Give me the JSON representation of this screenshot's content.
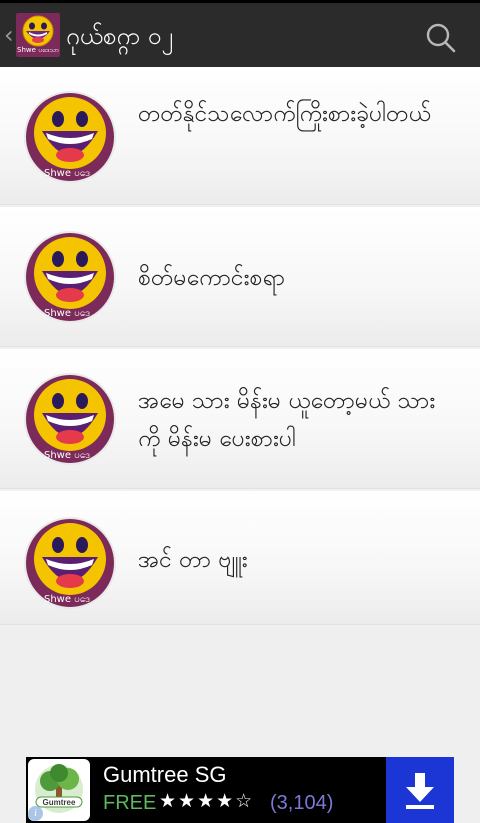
{
  "topbar": {
    "back_glyph": "‹",
    "app_icon_name": "smiley-app-icon",
    "app_icon_label": "Shwe ပဒေသာ",
    "title": "ဂုယ်စဂ္ဂာ ၀၂",
    "search_icon": "search-icon"
  },
  "list": {
    "items": [
      {
        "title": "တတ်နိုင်သလောက်ကြိုးစားခဲ့ပါတယ်",
        "avatar_caption": "Shwe ပဒေ",
        "icon": "laughing-face-icon"
      },
      {
        "title": "စိတ်မကောင်းစရာ",
        "avatar_caption": "Shwe ပဒေ",
        "icon": "laughing-face-icon"
      },
      {
        "title": "အမေ သား မိန်းမ ယူတော့မယ် သားကို မိန်းမ ပေးစားပါ",
        "avatar_caption": "Shwe ပဒေ",
        "icon": "laughing-face-icon"
      },
      {
        "title": "အင် တာ ဗျူး",
        "avatar_caption": "Shwe ပဒေ",
        "icon": "laughing-face-icon"
      }
    ]
  },
  "ad": {
    "app_name": "Gumtree SG",
    "price": "FREE",
    "stars": "★★★★☆",
    "rating": 4,
    "reviews": "(3,104)",
    "logo_text": "Gumtree",
    "download_icon": "download-icon",
    "info_glyph": "i",
    "colors": {
      "download_bg": "#1c36d6",
      "free": "#5fb85a",
      "reviews": "#7a7ad6"
    }
  }
}
